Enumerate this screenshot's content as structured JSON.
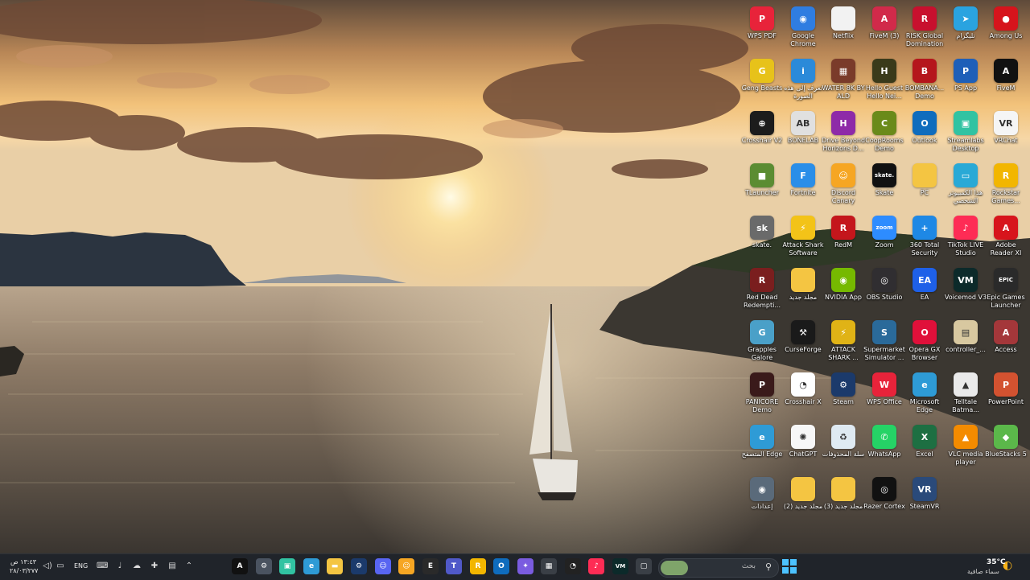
{
  "desktop": {
    "icons": [
      {
        "label": "WPS PDF",
        "icon": "wps-pdf-icon",
        "color": "#e8233a",
        "glyph": "P"
      },
      {
        "label": "Google Chrome",
        "icon": "chrome-icon",
        "color": "#2f7de1",
        "glyph": "◉"
      },
      {
        "label": "Netflix",
        "icon": "file-icon",
        "color": "#f2f2f2",
        "glyph": ""
      },
      {
        "label": "FiveM (3)",
        "icon": "fivem-icon",
        "color": "#d12a4a",
        "glyph": "A"
      },
      {
        "label": "RISK Global Domination",
        "icon": "risk-icon",
        "color": "#c8102e",
        "glyph": "R"
      },
      {
        "label": "تلیگرام",
        "icon": "telegram-icon",
        "color": "#2aa3e0",
        "glyph": "➤"
      },
      {
        "label": "Among Us",
        "icon": "among-us-icon",
        "color": "#d6141c",
        "glyph": "●"
      },
      {
        "label": "Geng Beasts",
        "icon": "gang-beasts-icon",
        "color": "#e7c21a",
        "glyph": "G"
      },
      {
        "label": "تعرف إلى هذه الصورة",
        "icon": "info-icon",
        "color": "#2b8ad9",
        "glyph": "i"
      },
      {
        "label": "WATER 8K BY ALD",
        "icon": "water-icon",
        "color": "#7a3b2a",
        "glyph": "▦"
      },
      {
        "label": "Hello Guest Hello Nei...",
        "icon": "hello-guest-icon",
        "color": "#3a3a1a",
        "glyph": "H"
      },
      {
        "label": "BOMBANA... Demo",
        "icon": "bombana-icon",
        "color": "#b5161c",
        "glyph": "B"
      },
      {
        "label": "PS App",
        "icon": "playstation-icon",
        "color": "#1e5fb8",
        "glyph": "P"
      },
      {
        "label": "FiveM",
        "icon": "fivem-icon",
        "color": "#111111",
        "glyph": "A"
      },
      {
        "label": "Crosshair V2",
        "icon": "crosshair-icon",
        "color": "#1c1c1c",
        "glyph": "⊕"
      },
      {
        "label": "BONELAB",
        "icon": "bonelab-icon",
        "color": "#e0e0e0",
        "glyph": "AB"
      },
      {
        "label": "Drive Beyond Horizons D...",
        "icon": "drive-icon",
        "color": "#8e2aa8",
        "glyph": "H"
      },
      {
        "label": "CoopRooms Demo",
        "icon": "cooprooms-icon",
        "color": "#6a8a1a",
        "glyph": "C"
      },
      {
        "label": "Outlook",
        "icon": "outlook-icon",
        "color": "#0f6cbd",
        "glyph": "O"
      },
      {
        "label": "Streamlabs Desktop",
        "icon": "streamlabs-icon",
        "color": "#31c3a2",
        "glyph": "▣"
      },
      {
        "label": "VRChat",
        "icon": "vrchat-icon",
        "color": "#f5f5f5",
        "glyph": "VR"
      },
      {
        "label": "TLauncher",
        "icon": "minecraft-icon",
        "color": "#5b8c32",
        "glyph": "■"
      },
      {
        "label": "Fortnite",
        "icon": "fortnite-icon",
        "color": "#2a8ee8",
        "glyph": "F"
      },
      {
        "label": "Discord Canary",
        "icon": "discord-icon",
        "color": "#f6a623",
        "glyph": "☺"
      },
      {
        "label": "Skate",
        "icon": "skate-icon",
        "color": "#111111",
        "glyph": "skate."
      },
      {
        "label": "PC",
        "icon": "folder-icon",
        "color": "#f4c542",
        "glyph": ""
      },
      {
        "label": "هذا الكمبيوتر الشخصي",
        "icon": "monitor-icon",
        "color": "#29a9d6",
        "glyph": "▭"
      },
      {
        "label": "Rockstar Games...",
        "icon": "rockstar-icon",
        "color": "#f2b600",
        "glyph": "R"
      },
      {
        "label": "skate.",
        "icon": "skate-game-icon",
        "color": "#6a6a6a",
        "glyph": "sk"
      },
      {
        "label": "Attack Shark Software",
        "icon": "attack-shark-icon",
        "color": "#f3c318",
        "glyph": "⚡"
      },
      {
        "label": "RedM",
        "icon": "redm-icon",
        "color": "#c4161c",
        "glyph": "R"
      },
      {
        "label": "Zoom",
        "icon": "zoom-icon",
        "color": "#2d8cff",
        "glyph": "zoom"
      },
      {
        "label": "360 Total Security",
        "icon": "security-icon",
        "color": "#1e88e5",
        "glyph": "+"
      },
      {
        "label": "TikTok LIVE Studio",
        "icon": "tiktok-icon",
        "color": "#fe2c55",
        "glyph": "♪"
      },
      {
        "label": "Adobe Reader XI",
        "icon": "adobe-icon",
        "color": "#d7141c",
        "glyph": "A"
      },
      {
        "label": "Red Dead Redempti...",
        "icon": "rdr-icon",
        "color": "#7a1e1e",
        "glyph": "R"
      },
      {
        "label": "مجلد جديد",
        "icon": "folder-icon",
        "color": "#f4c542",
        "glyph": ""
      },
      {
        "label": "NVIDIA App",
        "icon": "nvidia-icon",
        "color": "#76b900",
        "glyph": "◉"
      },
      {
        "label": "OBS Studio",
        "icon": "obs-icon",
        "color": "#302e31",
        "glyph": "◎"
      },
      {
        "label": "EA",
        "icon": "ea-icon",
        "color": "#1e60e8",
        "glyph": "EA"
      },
      {
        "label": "Voicemod V3",
        "icon": "voicemod-icon",
        "color": "#0c2a2a",
        "glyph": "VM"
      },
      {
        "label": "Epic Games Launcher",
        "icon": "epic-icon",
        "color": "#2a2a2a",
        "glyph": "EPIC"
      },
      {
        "label": "Grapples Galore",
        "icon": "grapples-icon",
        "color": "#4aa0c8",
        "glyph": "G"
      },
      {
        "label": "CurseForge",
        "icon": "curseforge-icon",
        "color": "#1a1a1a",
        "glyph": "⚒"
      },
      {
        "label": "ATTACK SHARK ...",
        "icon": "attack-shark-icon",
        "color": "#e0b316",
        "glyph": "⚡"
      },
      {
        "label": "Supermarket Simulator ...",
        "icon": "supermarket-icon",
        "color": "#2a6a9a",
        "glyph": "S"
      },
      {
        "label": "Opera GX Browser",
        "icon": "opera-icon",
        "color": "#e0103a",
        "glyph": "O"
      },
      {
        "label": "controller_...",
        "icon": "controller-icon",
        "color": "#d8c8a0",
        "glyph": "▤"
      },
      {
        "label": "Access",
        "icon": "access-icon",
        "color": "#a4373a",
        "glyph": "A"
      },
      {
        "label": "PANICORE Demo",
        "icon": "panicore-icon",
        "color": "#3a1a1a",
        "glyph": "P"
      },
      {
        "label": "Crosshair X",
        "icon": "crosshair-x-icon",
        "color": "#ffffff",
        "glyph": "◔"
      },
      {
        "label": "Steam",
        "icon": "steam-icon",
        "color": "#1b3a6b",
        "glyph": "⚙"
      },
      {
        "label": "WPS Office",
        "icon": "wps-office-icon",
        "color": "#e8233a",
        "glyph": "W"
      },
      {
        "label": "Microsoft Edge",
        "icon": "edge-icon",
        "color": "#2e9bd6",
        "glyph": "e"
      },
      {
        "label": "Telltale Batma...",
        "icon": "batman-icon",
        "color": "#eaeaea",
        "glyph": "▲"
      },
      {
        "label": "PowerPoint",
        "icon": "powerpoint-icon",
        "color": "#d35230",
        "glyph": "P"
      },
      {
        "label": "المتصفح Edge",
        "icon": "edge-icon",
        "color": "#2e9bd6",
        "glyph": "e"
      },
      {
        "label": "ChatGPT",
        "icon": "chatgpt-icon",
        "color": "#f7f7f7",
        "glyph": "✺"
      },
      {
        "label": "سلة المحذوفات",
        "icon": "recycle-bin-icon",
        "color": "#dfeaf2",
        "glyph": "♻"
      },
      {
        "label": "WhatsApp",
        "icon": "whatsapp-icon",
        "color": "#25d366",
        "glyph": "✆"
      },
      {
        "label": "Excel",
        "icon": "excel-icon",
        "color": "#1d6f42",
        "glyph": "X"
      },
      {
        "label": "VLC media player",
        "icon": "vlc-icon",
        "color": "#f48b00",
        "glyph": "▲"
      },
      {
        "label": "BlueStacks 5",
        "icon": "bluestacks-icon",
        "color": "#5bb84a",
        "glyph": "◆"
      },
      {
        "label": "إعدادات",
        "icon": "settings-icon",
        "color": "#5a6a7a",
        "glyph": "◉"
      },
      {
        "label": "مجلد جديد (2)",
        "icon": "folder-icon",
        "color": "#f4c542",
        "glyph": ""
      },
      {
        "label": "مجلد جديد (3)",
        "icon": "folder-icon",
        "color": "#f4c542",
        "glyph": ""
      },
      {
        "label": "Razer Cortex",
        "icon": "razer-icon",
        "color": "#111111",
        "glyph": "◎"
      },
      {
        "label": "SteamVR",
        "icon": "steamvr-icon",
        "color": "#2a4a7a",
        "glyph": "VR"
      }
    ]
  },
  "taskbar": {
    "weather_temp": "35°C",
    "weather_desc": "سماء صافية",
    "search_placeholder": "بحث",
    "language": "ENG",
    "clock_time": "١٣:٤٣ ص",
    "clock_date": "٢٨/٠٣/٢٧٧",
    "pinned": [
      {
        "icon": "fivem-icon",
        "color": "#111",
        "glyph": "A"
      },
      {
        "icon": "settings-gear-icon",
        "color": "#4a5360",
        "glyph": "⚙"
      },
      {
        "icon": "streamlabs-icon",
        "color": "#31c3a2",
        "glyph": "▣"
      },
      {
        "icon": "edge-icon",
        "color": "#2e9bd6",
        "glyph": "e"
      },
      {
        "icon": "file-explorer-icon",
        "color": "#f4c542",
        "glyph": "▬"
      },
      {
        "icon": "steam-icon",
        "color": "#1b3a6b",
        "glyph": "⚙"
      },
      {
        "icon": "discord-icon",
        "color": "#5865f2",
        "glyph": "☺"
      },
      {
        "icon": "discord-canary-icon",
        "color": "#f6a623",
        "glyph": "☺"
      },
      {
        "icon": "epic-icon",
        "color": "#2a2a2a",
        "glyph": "E"
      },
      {
        "icon": "teams-icon",
        "color": "#5059c9",
        "glyph": "T"
      },
      {
        "icon": "rockstar-icon",
        "color": "#f2b600",
        "glyph": "R"
      },
      {
        "icon": "outlook-icon",
        "color": "#0f6cbd",
        "glyph": "O"
      },
      {
        "icon": "copilot-icon",
        "color": "#7a5ce0",
        "glyph": "✦"
      },
      {
        "icon": "calendar-icon",
        "color": "#3a3f46",
        "glyph": "▦"
      },
      {
        "icon": "crosshair-x-icon",
        "color": "#222",
        "glyph": "◔"
      },
      {
        "icon": "tiktok-icon",
        "color": "#fe2c55",
        "glyph": "♪"
      },
      {
        "icon": "voicemod-icon",
        "color": "#0c2a2a",
        "glyph": "VM"
      },
      {
        "icon": "task-view-icon",
        "color": "#3a3f46",
        "glyph": "▢"
      }
    ]
  }
}
